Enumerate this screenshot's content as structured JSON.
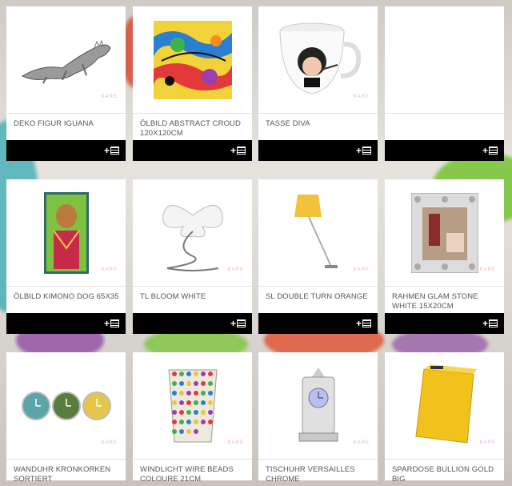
{
  "products": [
    {
      "name": "DEKO FIGUR IGUANA",
      "icon": "iguana-figure"
    },
    {
      "name": "ÖLBILD ABSTRACT CROUD 120X120CM",
      "icon": "abstract-painting"
    },
    {
      "name": "TASSE DIVA",
      "icon": "diva-mug"
    },
    {
      "name": "",
      "icon": "blank"
    },
    {
      "name": "ÖLBILD KIMONO DOG 65X35",
      "icon": "dog-painting"
    },
    {
      "name": "TL BLOOM WHITE",
      "icon": "bloom-lamp"
    },
    {
      "name": "SL DOUBLE TURN ORANGE",
      "icon": "floor-lamp"
    },
    {
      "name": "RAHMEN GLAM STONE WHITE 15X20CM",
      "icon": "photo-frame"
    },
    {
      "name": "WANDUHR KRONKORKEN SORTIERT",
      "icon": "wall-clocks"
    },
    {
      "name": "WINDLICHT WIRE BEADS COLOURE 21CM",
      "icon": "beaded-lantern"
    },
    {
      "name": "TISCHUHR VERSAILLES CHROME",
      "icon": "table-clock"
    },
    {
      "name": "SPARDOSE BULLION GOLD BIG",
      "icon": "gold-bar-bank"
    }
  ],
  "add_button": {
    "plus": "+"
  },
  "watermark": "KARE"
}
